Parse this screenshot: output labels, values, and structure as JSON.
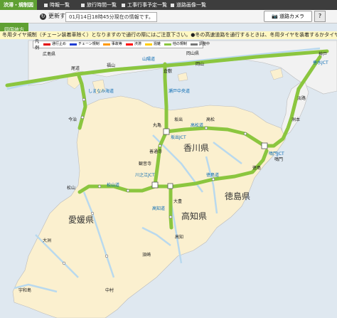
{
  "nav": {
    "items": [
      {
        "label": "渋滞・規制図",
        "active": true
      },
      {
        "label": "時報一覧",
        "active": false
      },
      {
        "label": "旅行時間一覧",
        "active": false
      },
      {
        "label": "工事行事予定一覧",
        "active": false
      },
      {
        "label": "道路画像一覧",
        "active": false
      }
    ]
  },
  "toolbar": {
    "refresh_label": "更新する",
    "update_time": "01月14日18時45分現在の情報です。",
    "camera_label": "道路カメラ",
    "help_label": "?"
  },
  "region_tab": {
    "label": "四国地方"
  },
  "ticker": {
    "text": "冬用タイヤ規制（チェーン装着車除く）となりますので通行の際にはご注意下さい。●冬の高速道路を通行するときは、冬用タイヤを装着するかタイヤチェー"
  },
  "legend": {
    "title": "凡例",
    "items": [
      {
        "label": "通行止め",
        "color": "#e30000"
      },
      {
        "label": "チェーン規制",
        "color": "#1e3cd2"
      },
      {
        "label": "事故等",
        "color": "#ff9900"
      },
      {
        "label": "渋滞",
        "color": "#ff0000"
      },
      {
        "label": "混雑",
        "color": "#ffcc00"
      },
      {
        "label": "他の規制",
        "color": "#8bc63f"
      },
      {
        "label": "調整中",
        "color": "#777777"
      }
    ]
  },
  "colors": {
    "sea": "#dfe8f0",
    "land": "#fbf0cf",
    "honshu": "#f2f2f2",
    "highway": "#8bc63f",
    "national_road": "#b9d9ee",
    "accent": "#5fa033"
  },
  "map": {
    "prefectures": [
      {
        "name": "香川県"
      },
      {
        "name": "徳島県"
      },
      {
        "name": "愛媛県"
      },
      {
        "name": "高知県"
      }
    ],
    "highway_labels": [
      {
        "name": "山陽道"
      },
      {
        "name": "松山道"
      },
      {
        "name": "高松道"
      },
      {
        "name": "徳島道"
      },
      {
        "name": "高知道"
      },
      {
        "name": "しまなみ海道"
      },
      {
        "name": "瀬戸中央道"
      }
    ],
    "junctions": [
      {
        "name": "川之江JCT"
      },
      {
        "name": "坂出JCT"
      },
      {
        "name": "鳴門JCT"
      },
      {
        "name": "垂水JCT"
      }
    ],
    "places": [
      {
        "name": "広島県"
      },
      {
        "name": "岡山県"
      },
      {
        "name": "尾道"
      },
      {
        "name": "福山"
      },
      {
        "name": "倉敷"
      },
      {
        "name": "岡山"
      },
      {
        "name": "今治"
      },
      {
        "name": "松山"
      },
      {
        "name": "大洲"
      },
      {
        "name": "宇和島"
      },
      {
        "name": "高松"
      },
      {
        "name": "坂出"
      },
      {
        "name": "丸亀"
      },
      {
        "name": "善通寺"
      },
      {
        "name": "観音寺"
      },
      {
        "name": "鳴門"
      },
      {
        "name": "徳島"
      },
      {
        "name": "高知"
      },
      {
        "name": "須崎"
      },
      {
        "name": "中村"
      },
      {
        "name": "大豊"
      },
      {
        "name": "淡路"
      },
      {
        "name": "洲本"
      },
      {
        "name": "神戸"
      }
    ]
  }
}
